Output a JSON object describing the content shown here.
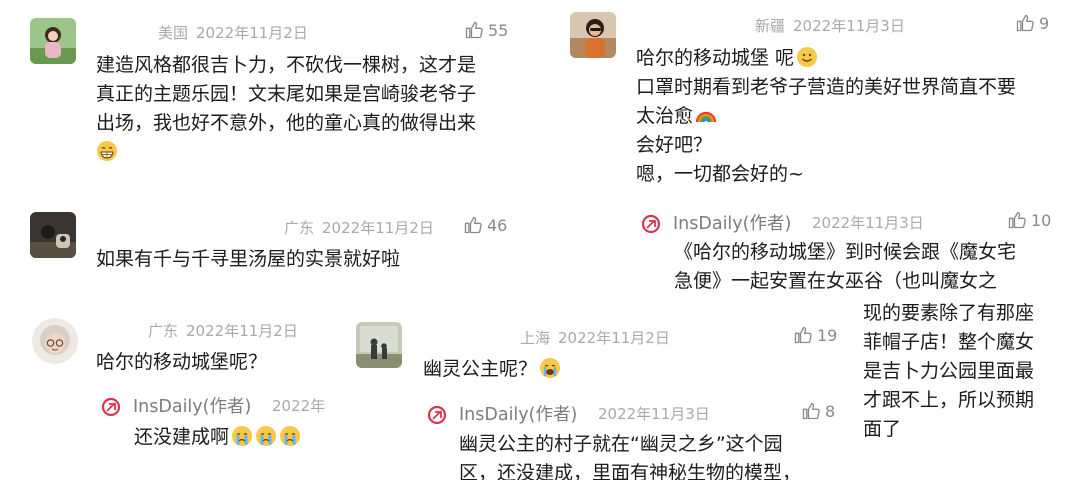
{
  "comments": [
    {
      "location": "美国",
      "date": "2022年11月2日",
      "likes": "55",
      "lines": [
        "建造风格都很吉卜力，不砍伐一棵树，这才是",
        "真正的主题乐园！文末尾如果是宫崎骏老爷子",
        "出场，我也好不意外，他的童心真的做得出来"
      ],
      "emoji": "grin-emoji"
    },
    {
      "location": "新疆",
      "date": "2022年11月3日",
      "likes": "9",
      "lines": [
        "哈尔的移动城堡 呢",
        "口罩时期看到老爷子营造的美好世界简直不要",
        "太治愈",
        "会好吧？",
        "嗯，一切都会好的~"
      ],
      "reply": {
        "author": "InsDaily(作者)",
        "date": "2022年11月3日",
        "likes": "10",
        "lines": [
          "《哈尔的移动城堡》到时候会跟《魔女宅",
          "急便》一起安置在女巫谷（也叫魔女之",
          "现的要素除了有那座",
          "菲帽子店！整个魔女",
          "是吉卜力公园里面最",
          "才跟不上，所以预期",
          "面了"
        ]
      }
    },
    {
      "location": "广东",
      "date": "2022年11月2日",
      "likes": "46",
      "lines": [
        "如果有千与千寻里汤屋的实景就好啦"
      ]
    },
    {
      "location": "广东",
      "date": "2022年11月2日",
      "lines": [
        "哈尔的移动城堡呢？"
      ],
      "reply": {
        "author": "InsDaily(作者)",
        "date": "2022年",
        "lines": [
          "还没建成啊"
        ]
      }
    },
    {
      "location": "上海",
      "date": "2022年11月2日",
      "likes": "19",
      "lines": [
        "幽灵公主呢？"
      ],
      "reply": {
        "author": "InsDaily(作者)",
        "date": "2022年11月3日",
        "likes": "8",
        "lines": [
          "幽灵公主的村子就在“幽灵之乡”这个园",
          "区，还没建成，里面有神秘生物的模型，"
        ]
      }
    }
  ]
}
